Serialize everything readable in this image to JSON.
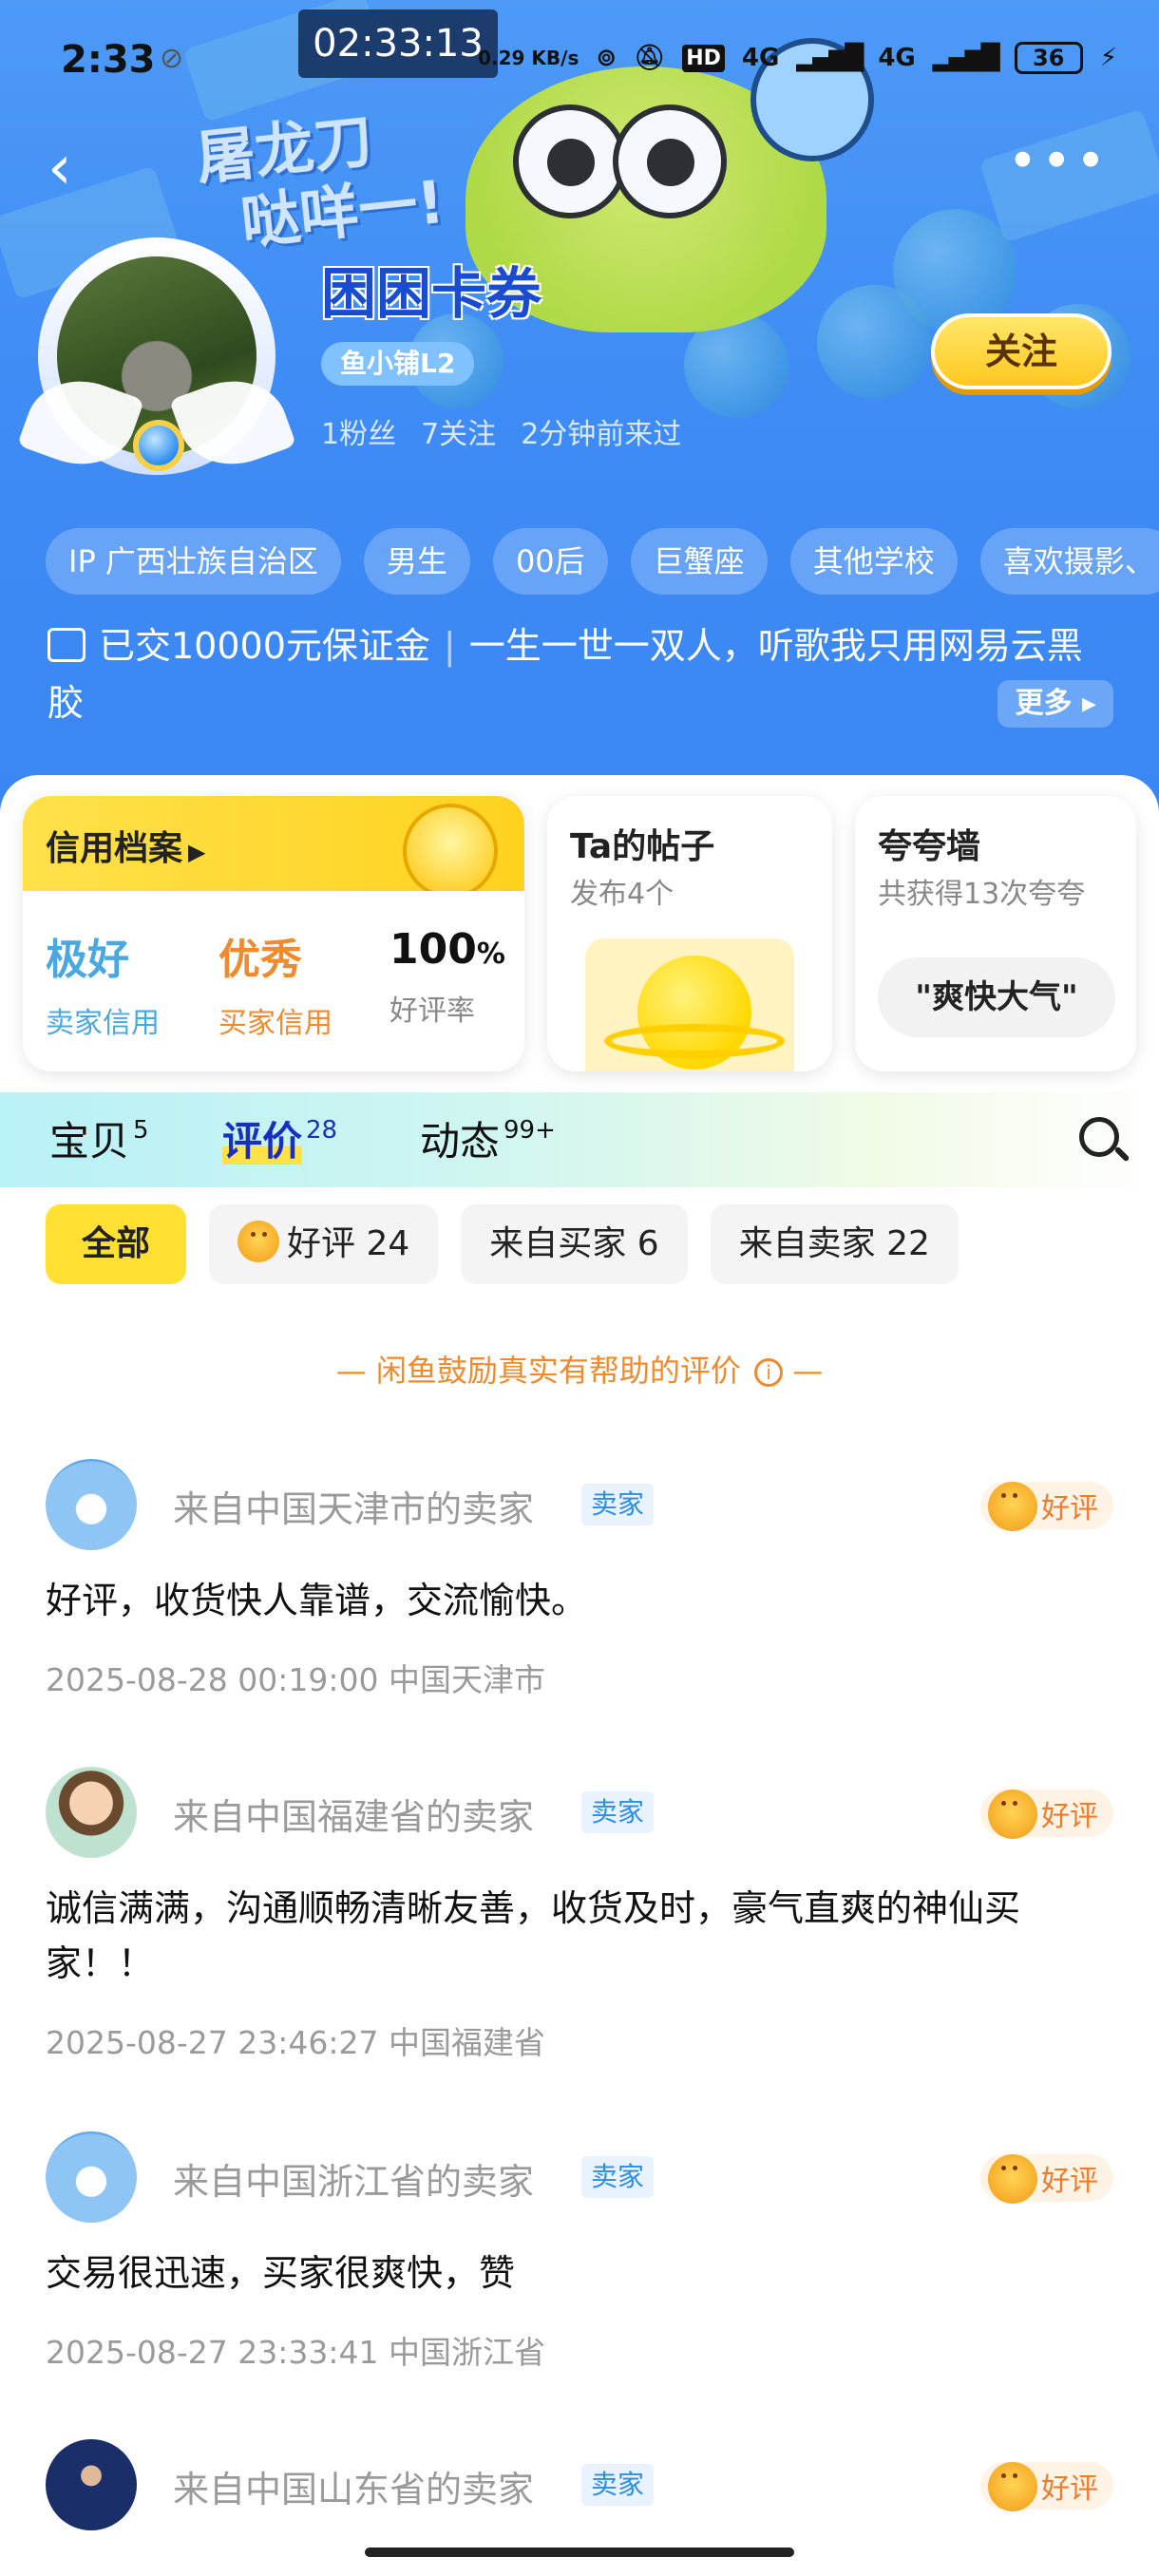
{
  "status_bar": {
    "time": "2:33",
    "recording_timer": "02:33:13",
    "net_speed": "0.29 KB/s",
    "hd_label": "HD",
    "net1": "4G",
    "net2": "4G",
    "battery": "36"
  },
  "header": {
    "slogan_line1": "屠龙刀",
    "slogan_line2": "哒咩一!",
    "shop_name": "困困卡券",
    "shop_level": "鱼小铺L2",
    "stats": {
      "fans": "1粉丝",
      "following": "7关注",
      "last_visit": "2分钟前来过"
    },
    "follow_label": "关注",
    "tags": [
      "IP 广西壮族自治区",
      "男生",
      "00后",
      "巨蟹座",
      "其他学校",
      "喜欢摄影、"
    ],
    "deposit_text": "已交10000元保证金",
    "bio_text": "一生一世一双人，听歌我只用网易云黑胶",
    "more_label": "更多"
  },
  "cards": {
    "credit": {
      "title": "信用档案",
      "seller_value": "极好",
      "seller_label": "卖家信用",
      "buyer_value": "优秀",
      "buyer_label": "买家信用",
      "rate_value": "100",
      "rate_unit": "%",
      "rate_label": "好评率"
    },
    "posts": {
      "title": "Ta的帖子",
      "subtitle": "发布4个"
    },
    "praise": {
      "title": "夸夸墙",
      "subtitle": "共获得13次夸夸",
      "pill": "\"爽快大气\""
    }
  },
  "tabs": [
    {
      "label": "宝贝",
      "count": "5"
    },
    {
      "label": "评价",
      "count": "28"
    },
    {
      "label": "动态",
      "count": "99+"
    }
  ],
  "filters": {
    "all": "全部",
    "good": "好评 24",
    "from_buyer": "来自买家 6",
    "from_seller": "来自卖家 22"
  },
  "notice": "— 闲鱼鼓励真实有帮助的评价",
  "notice_end": " —",
  "reviews": [
    {
      "who": "来自中国天津市的卖家",
      "role": "卖家",
      "rating": "好评",
      "text": "好评，收货快人靠谱，交流愉快。",
      "meta": "2025-08-28 00:19:00  中国天津市"
    },
    {
      "who": "来自中国福建省的卖家",
      "role": "卖家",
      "rating": "好评",
      "text": "诚信满满，沟通顺畅清晰友善，收货及时，豪气直爽的神仙买家！！",
      "meta": "2025-08-27 23:46:27  中国福建省"
    },
    {
      "who": "来自中国浙江省的卖家",
      "role": "卖家",
      "rating": "好评",
      "text": "交易很迅速，买家很爽快，赞",
      "meta": "2025-08-27 23:33:41  中国浙江省"
    },
    {
      "who": "来自中国山东省的卖家",
      "role": "卖家",
      "rating": "好评"
    }
  ]
}
